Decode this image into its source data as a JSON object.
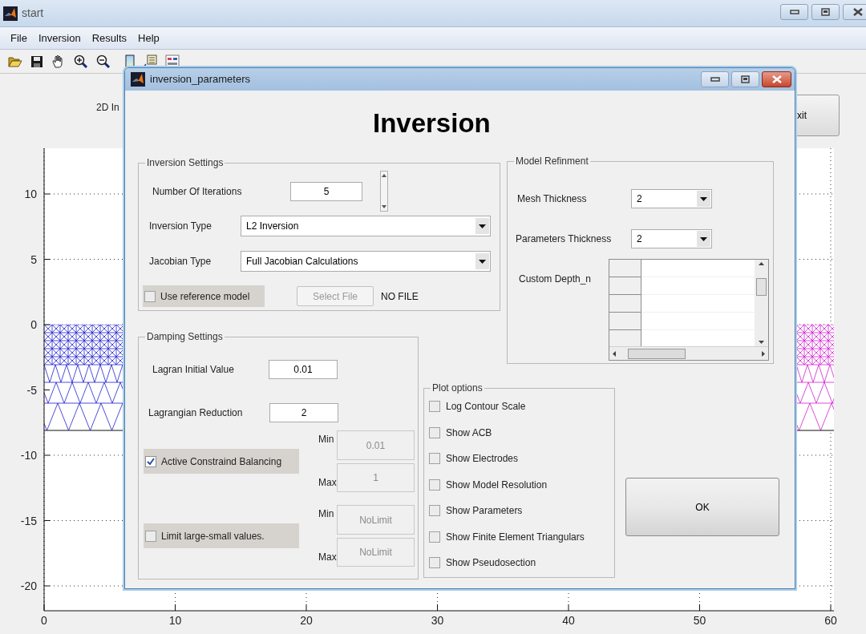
{
  "main_window": {
    "title": "start",
    "menu": [
      "File",
      "Inversion",
      "Results",
      "Help"
    ],
    "header_text": "2D In",
    "exit_button": "xit",
    "plot": {
      "y_tick_labels": [
        "10",
        "5",
        "0",
        "-5",
        "-10",
        "-15",
        "-20"
      ],
      "x_tick_labels": [
        "0",
        "10",
        "20",
        "30",
        "40",
        "50",
        "60"
      ]
    }
  },
  "dialog": {
    "title": "inversion_parameters",
    "heading": "Inversion",
    "inversion_settings": {
      "title": "Inversion Settings",
      "iterations": {
        "label": "Number Of Iterations",
        "value": "5"
      },
      "inversion_type": {
        "label": "Inversion Type",
        "value": "L2 Inversion"
      },
      "jacobian_type": {
        "label": "Jacobian Type",
        "value": "Full Jacobian Calculations"
      },
      "reference_model": {
        "label": "Use reference model",
        "checked": false
      },
      "select_file": {
        "label": "Select File",
        "disabled": true
      },
      "file_status": "NO FILE"
    },
    "model_refinement": {
      "title": "Model Refinment",
      "mesh_thickness": {
        "label": "Mesh Thickness",
        "value": "2"
      },
      "parameters_thickness": {
        "label": "Parameters Thickness",
        "value": "2"
      },
      "custom_depth": {
        "label": "Custom Depth_n"
      }
    },
    "damping_settings": {
      "title": "Damping Settings",
      "initial_value": {
        "label": "Lagran Initial Value",
        "value": "0.01"
      },
      "reduction": {
        "label": "Lagrangian Reduction",
        "value": "2"
      },
      "constraints": [
        {
          "label": "Active Constraind Balancing",
          "checked": true,
          "min": {
            "label": "Min",
            "value": "0.01",
            "disabled": true
          },
          "max": {
            "label": "Max",
            "value": "1",
            "disabled": true
          }
        },
        {
          "label": "Limit large-small values.",
          "checked": false,
          "min": {
            "label": "Min",
            "value": "NoLimit",
            "disabled": true
          },
          "max": {
            "label": "Max",
            "value": "NoLimit",
            "disabled": true
          }
        }
      ]
    },
    "plot_options": {
      "title": "Plot options",
      "options": [
        {
          "label": "Log Contour Scale",
          "checked": false
        },
        {
          "label": "Show ACB",
          "checked": false
        },
        {
          "label": "Show Electrodes",
          "checked": false
        },
        {
          "label": "Show Model Resolution",
          "checked": false
        },
        {
          "label": "Show Parameters",
          "checked": false
        },
        {
          "label": "Show Finite Element Triangulars",
          "checked": false
        },
        {
          "label": "Show Pseudosection",
          "checked": false
        }
      ]
    },
    "ok_button": "OK"
  }
}
